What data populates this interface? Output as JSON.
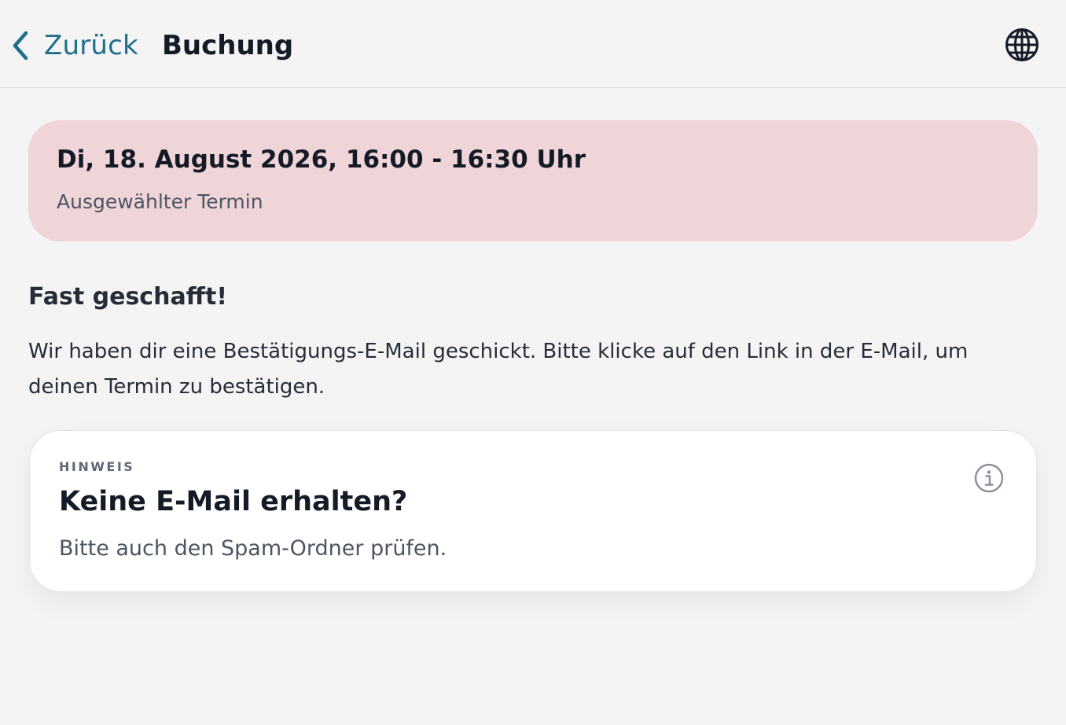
{
  "header": {
    "back_label": "Zurück",
    "title": "Buchung",
    "back_icon": "chevron-left-icon",
    "language_icon": "globe-icon"
  },
  "appointment": {
    "datetime": "Di, 18. August 2026, 16:00 - 16:30 Uhr",
    "caption": "Ausgewählter Termin"
  },
  "confirmation": {
    "heading": "Fast geschafft!",
    "body": "Wir haben dir eine Bestätigungs-E-Mail geschickt. Bitte klicke auf den Link in der E-Mail, um deinen Termin zu bestätigen."
  },
  "hint": {
    "eyebrow": "HINWEIS",
    "title": "Keine E-Mail erhalten?",
    "text": "Bitte auch den Spam-Ordner prüfen.",
    "icon": "info-icon"
  },
  "colors": {
    "background": "#f4f4f4",
    "accent": "#1f6e8c",
    "appointment_card": "#f0d5d8",
    "hint_card": "#ffffff",
    "text_primary": "#141a26",
    "text_secondary": "#4d5562"
  }
}
